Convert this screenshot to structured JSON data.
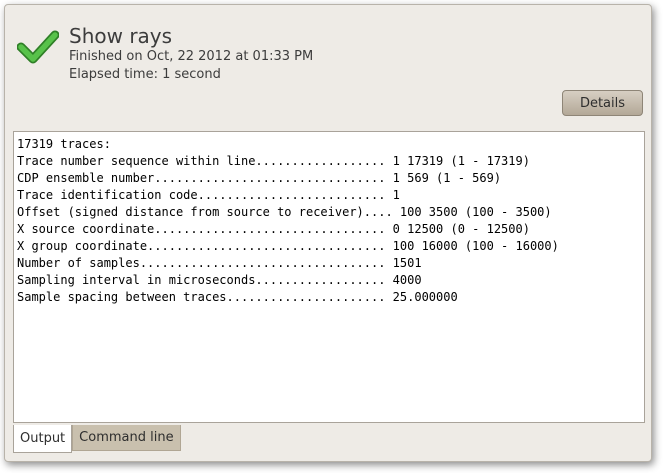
{
  "header": {
    "title": "Show rays",
    "finished": "Finished on Oct, 22 2012 at 01:33 PM",
    "elapsed": "Elapsed time: 1 second",
    "status_icon": "checkmark-icon",
    "status_color": "#3fa535"
  },
  "actions": {
    "details_label": "Details"
  },
  "output": {
    "lines": [
      "17319 traces:",
      "Trace number sequence within line.................. 1 17319 (1 - 17319)",
      "CDP ensemble number................................ 1 569 (1 - 569)",
      "Trace identification code.......................... 1",
      "Offset (signed distance from source to receiver).... 100 3500 (100 - 3500)",
      "X source coordinate................................ 0 12500 (0 - 12500)",
      "X group coordinate................................. 100 16000 (100 - 16000)",
      "Number of samples.................................. 1501",
      "Sampling interval in microseconds.................. 4000",
      "Sample spacing between traces...................... 25.000000"
    ]
  },
  "tabs": [
    {
      "label": "Output",
      "active": true
    },
    {
      "label": "Command line",
      "active": false
    }
  ]
}
